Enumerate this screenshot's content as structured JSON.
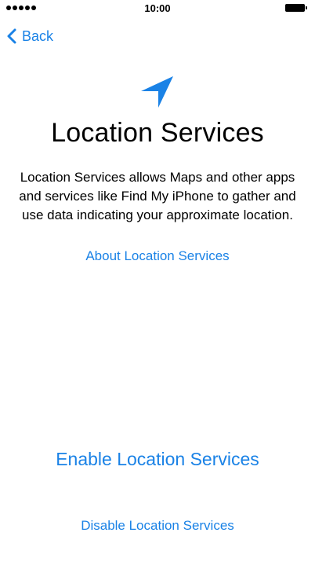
{
  "status_bar": {
    "time": "10:00",
    "signal_icon": "signal-dots-icon",
    "battery_icon": "battery-icon"
  },
  "nav": {
    "back_label": "Back",
    "back_icon": "chevron-left-icon"
  },
  "hero": {
    "icon": "location-arrow-icon",
    "accent_color": "#1a82e6"
  },
  "title": "Location Services",
  "description": "Location Services allows Maps and other apps and services like Find My iPhone to gather and use data indicating your approximate location.",
  "about_link": "About Location Services",
  "actions": {
    "enable_label": "Enable Location Services",
    "disable_label": "Disable Location Services"
  }
}
